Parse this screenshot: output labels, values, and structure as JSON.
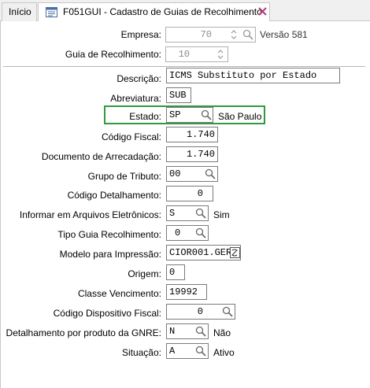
{
  "tabs": [
    {
      "label": "Início"
    },
    {
      "label": "F051GUI - Cadastro de Guias de Recolhimento"
    }
  ],
  "form": {
    "empresa": {
      "label": "Empresa:",
      "value": "70",
      "note": "Versão 581"
    },
    "guia": {
      "label": "Guia de Recolhimento:",
      "value": "10"
    },
    "descricao": {
      "label": "Descrição:",
      "value": "ICMS Substituto por Estado"
    },
    "abreviatura": {
      "label": "Abreviatura:",
      "value": "SUB"
    },
    "estado": {
      "label": "Estado:",
      "value": "SP",
      "description": "São Paulo"
    },
    "codigo_fiscal": {
      "label": "Código  Fiscal:",
      "value": "1.740"
    },
    "documento_arrecadacao": {
      "label": "Documento de Arrecadação:",
      "value": "1.740"
    },
    "grupo_tributo": {
      "label": "Grupo de Tributo:",
      "value": "00"
    },
    "codigo_detalhamento": {
      "label": "Código Detalhamento:",
      "value": "0"
    },
    "arquivos_eletronicos": {
      "label": "Informar em Arquivos Eletrônicos:",
      "value": "S",
      "description": "Sim"
    },
    "tipo_guia": {
      "label": "Tipo Guia Recolhimento:",
      "value": "0"
    },
    "modelo_impressao": {
      "label": "Modelo para Impressão:",
      "value": "CIOR001.GER"
    },
    "origem": {
      "label": "Origem:",
      "value": "0"
    },
    "classe_vencimento": {
      "label": "Classe Vencimento:",
      "value": "19992"
    },
    "codigo_dispositivo": {
      "label": "Código Dispositivo Fiscal:",
      "value": "0"
    },
    "detalhamento_gnre": {
      "label": "Detalhamento por produto da GNRE:",
      "value": "N",
      "description": "Não"
    },
    "situacao": {
      "label": "Situação:",
      "value": "A",
      "description": "Ativo"
    }
  },
  "colors": {
    "highlight": "#2e9b3f",
    "close_icon": "#b0407a"
  },
  "icons": [
    "document-icon",
    "close-icon",
    "spinner-icon",
    "search-icon",
    "folder-icon"
  ]
}
